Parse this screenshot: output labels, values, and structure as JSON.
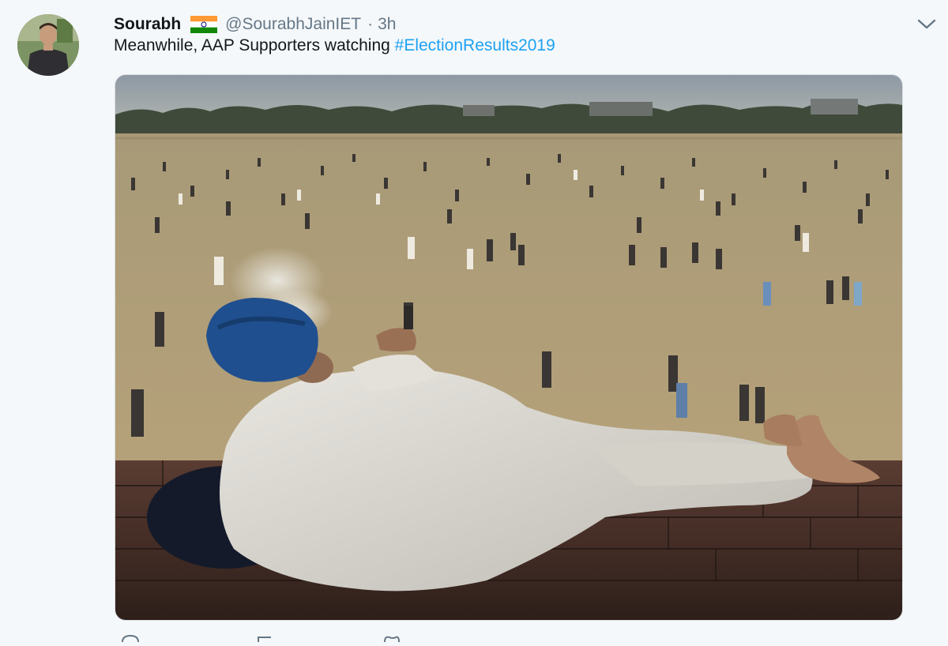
{
  "tweet": {
    "author_name": "Sourabh",
    "flag_icon": "india-flag-icon",
    "handle": "@SourabhJainIET",
    "separator": "·",
    "time": "3h",
    "text": "Meanwhile, AAP Supporters watching ",
    "hashtag": "#ElectionResults2019",
    "hashtag_color": "#1da1f2",
    "menu_icon": "chevron-down-icon"
  },
  "actions": {
    "icons": [
      "reply-icon",
      "retweet-icon",
      "like-icon"
    ]
  }
}
